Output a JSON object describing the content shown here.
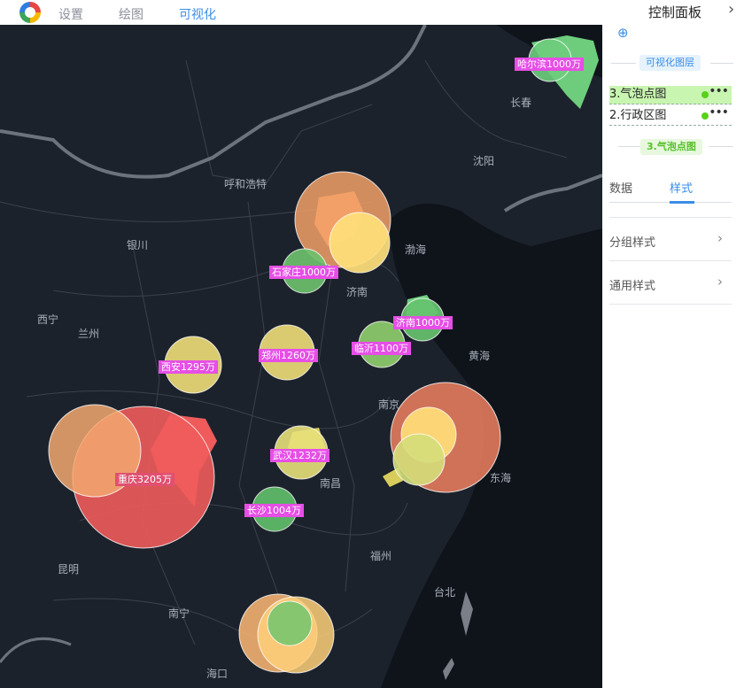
{
  "nav": {
    "settings": "设置",
    "draw": "绘图",
    "visualize": "可视化"
  },
  "panel": {
    "title": "控制面板",
    "chevron": "›",
    "add_icon": "⊕",
    "layers_heading": "可视化图层",
    "layers": [
      {
        "label": "3.气泡点图",
        "more": "•••"
      },
      {
        "label": "2.行政区图",
        "more": "•••"
      }
    ],
    "current_layer": "3.气泡点图",
    "tabs": {
      "data": "数据",
      "style": "样式"
    },
    "sections": [
      {
        "label": "分组样式",
        "chevron": "›"
      },
      {
        "label": "通用样式",
        "chevron": "›"
      }
    ],
    "colors": {
      "accent": "#3a8ee6",
      "layer_highlight": "#c8f5b0",
      "layer_green": "#58d21a"
    }
  },
  "map": {
    "cities": [
      "长春",
      "沈阳",
      "呼和浩特",
      "银川",
      "西宁",
      "兰州",
      "济南",
      "渤海",
      "黄海",
      "南京",
      "东海",
      "南昌",
      "福州",
      "台北",
      "昆明",
      "南宁",
      "海口"
    ],
    "bubble_labels": [
      "哈尔滨1000万",
      "石家庄1000万",
      "济南1000万",
      "临沂1100万",
      "郑州1260万",
      "西安1295万",
      "武汉1232万",
      "长沙1004万",
      "重庆3205万"
    ],
    "colors": {
      "background": "#1c222b",
      "label_bg": "#e64ee6"
    }
  }
}
